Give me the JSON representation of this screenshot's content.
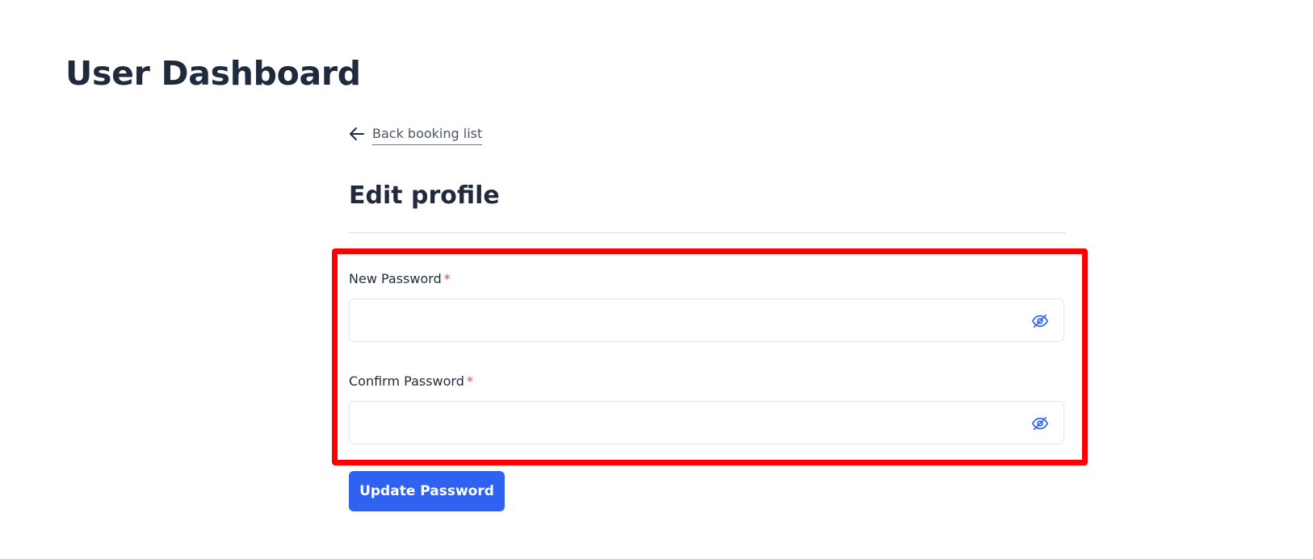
{
  "header": {
    "title": "User Dashboard"
  },
  "back_link": {
    "label": "Back booking list",
    "icon": "arrow-left-icon"
  },
  "form": {
    "title": "Edit profile",
    "required_marker": "*",
    "new_password": {
      "label": "New Password",
      "value": "",
      "toggle_icon": "eye-off-icon"
    },
    "confirm_password": {
      "label": "Confirm Password",
      "value": "",
      "toggle_icon": "eye-off-icon"
    },
    "submit_label": "Update Password"
  },
  "colors": {
    "primary": "#2f62f0",
    "highlight": "#ff0000",
    "required": "#ef4444",
    "text": "#1f2a3c"
  }
}
